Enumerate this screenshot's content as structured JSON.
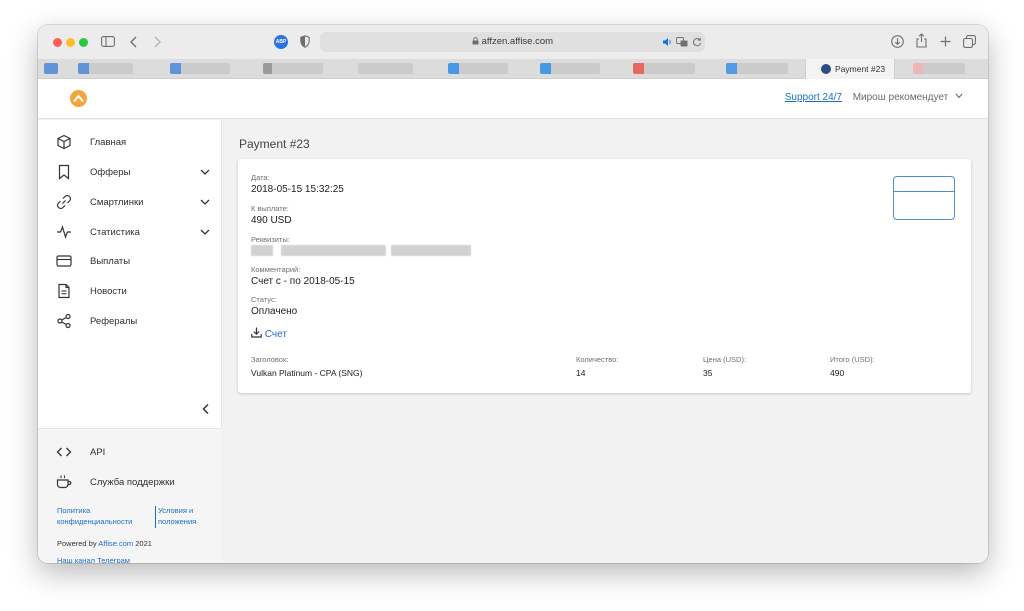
{
  "browser": {
    "url": "affzen.affise.com",
    "active_tab_title": "Payment #23",
    "adblock_label": "ABP",
    "colors": {
      "close": "#fe5f57",
      "minimize": "#febc2e",
      "maximize": "#28c840"
    }
  },
  "header": {
    "support_link": "Support 24/7",
    "user_menu": "Мирош рекомендует"
  },
  "sidebar": {
    "items": [
      {
        "label": "Главная",
        "icon": "cube-icon",
        "expandable": false
      },
      {
        "label": "Офферы",
        "icon": "bookmark-icon",
        "expandable": true
      },
      {
        "label": "Смартлинки",
        "icon": "link-icon",
        "expandable": true
      },
      {
        "label": "Статистика",
        "icon": "activity-icon",
        "expandable": true
      },
      {
        "label": "Выплаты",
        "icon": "credit-card-icon",
        "expandable": false
      },
      {
        "label": "Новости",
        "icon": "document-icon",
        "expandable": false
      },
      {
        "label": "Рефералы",
        "icon": "share-icon",
        "expandable": false
      }
    ],
    "footer": {
      "api_label": "API",
      "support_label": "Служба поддержки",
      "privacy_link": "Политика конфиденциальности",
      "terms_link": "Условия и положения",
      "powered_prefix": "Powered by",
      "powered_link": "Affise.com",
      "powered_year": "2021",
      "telegram_link": "Наш канал Телеграм"
    }
  },
  "payment": {
    "title": "Payment #23",
    "date_label": "Дата:",
    "date_value": "2018-05-15 15:32:25",
    "amount_label": "К выплате:",
    "amount_value": "490 USD",
    "requisites_label": "Реквизиты:",
    "comment_label": "Комментарий:",
    "comment_value": "Счет с - по 2018-05-15",
    "status_label": "Статус:",
    "status_value": "Оплачено",
    "invoice_link": "Счет",
    "table": {
      "headers": [
        "Заголовок:",
        "Количество:",
        "Цена (USD):",
        "Итого (USD):"
      ],
      "row": [
        "Vulkan Platinum - CPA (SNG)",
        "14",
        "35",
        "490"
      ]
    }
  }
}
